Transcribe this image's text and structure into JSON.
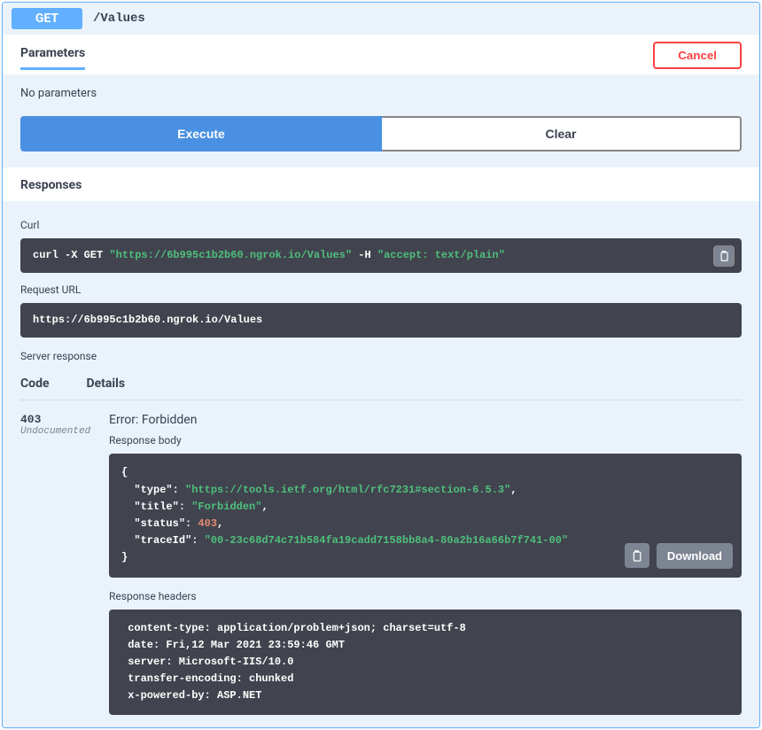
{
  "op": {
    "method": "GET",
    "path": "/Values"
  },
  "params": {
    "title": "Parameters",
    "cancel": "Cancel",
    "none": "No parameters",
    "execute": "Execute",
    "clear": "Clear"
  },
  "responses": {
    "title": "Responses"
  },
  "curl": {
    "label": "Curl",
    "cmd_prefix": "curl -X GET ",
    "url": "\"https://6b995c1b2b60.ngrok.io/Values\"",
    "h_flag": " -H  ",
    "accept": "\"accept: text/plain\""
  },
  "request_url": {
    "label": "Request URL",
    "value": "https://6b995c1b2b60.ngrok.io/Values"
  },
  "server_response": {
    "label": "Server response",
    "code_header": "Code",
    "details_header": "Details"
  },
  "resp": {
    "code": "403",
    "note": "Undocumented",
    "error_title": "Error: Forbidden",
    "body_label": "Response body",
    "download": "Download",
    "body": {
      "type_k": "\"type\"",
      "type_v": "\"https://tools.ietf.org/html/rfc7231#section-6.5.3\"",
      "title_k": "\"title\"",
      "title_v": "\"Forbidden\"",
      "status_k": "\"status\"",
      "status_v": "403",
      "trace_k": "\"traceId\"",
      "trace_v": "\"00-23c68d74c71b584fa19cadd7158bb8a4-80a2b16a66b7f741-00\""
    },
    "headers_label": "Response headers",
    "headers": " content-type: application/problem+json; charset=utf-8 \n date: Fri,12 Mar 2021 23:59:46 GMT \n server: Microsoft-IIS/10.0 \n transfer-encoding: chunked \n x-powered-by: ASP.NET "
  }
}
